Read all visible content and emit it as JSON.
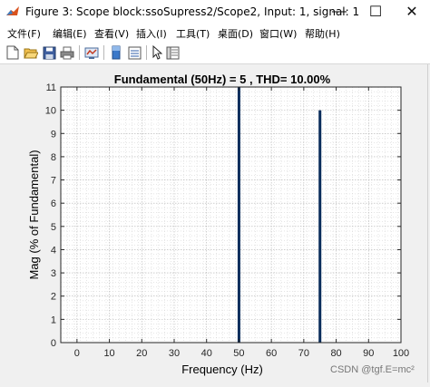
{
  "window": {
    "title": "Figure 3: Scope block:ssoSupress2/Scope2, Input: 1, signal: 1",
    "minimize_glyph": "—",
    "maximize_glyph": "☐",
    "close_glyph": "✕"
  },
  "menu": {
    "items": [
      {
        "label": "文件(F)"
      },
      {
        "label": "编辑(E)"
      },
      {
        "label": "查看(V)"
      },
      {
        "label": "插入(I)"
      },
      {
        "label": "工具(T)"
      },
      {
        "label": "桌面(D)"
      },
      {
        "label": "窗口(W)"
      },
      {
        "label": "帮助(H)"
      }
    ]
  },
  "toolbar": {
    "icons": [
      "new-figure-icon",
      "open-icon",
      "save-icon",
      "print-icon",
      "link-plot-icon",
      "insert-colorbar-icon",
      "pointer-icon",
      "property-inspector-icon"
    ]
  },
  "chart_data": {
    "type": "bar",
    "title": "Fundamental (50Hz) = 5 , THD= 10.00%",
    "xlabel": "Frequency (Hz)",
    "ylabel": "Mag (% of Fundamental)",
    "xlim": [
      -5,
      100
    ],
    "ylim": [
      0,
      11
    ],
    "xticks": [
      0,
      10,
      20,
      30,
      40,
      50,
      60,
      70,
      80,
      90,
      100
    ],
    "yticks": [
      0,
      1,
      2,
      3,
      4,
      5,
      6,
      7,
      8,
      9,
      10,
      11
    ],
    "grid": true,
    "minor_grid": true,
    "bar_color": "#0b2d5c",
    "bars": [
      {
        "x": 50,
        "y": 11
      },
      {
        "x": 75,
        "y": 10
      }
    ]
  },
  "watermark": "CSDN @tgf.E=mc²"
}
